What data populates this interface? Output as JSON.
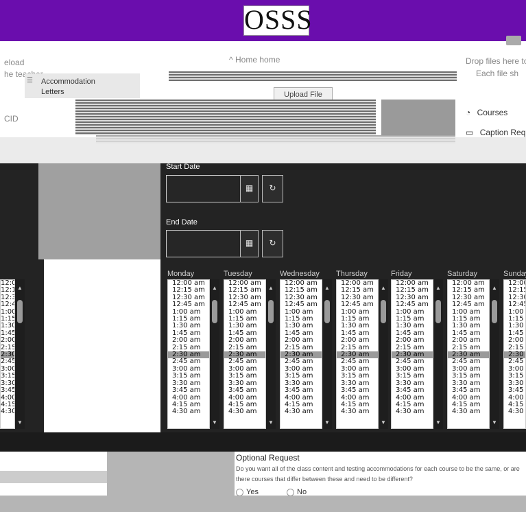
{
  "header": {
    "logo_text": "OSSS"
  },
  "nav": {
    "home_label": "Home",
    "home_crumb": "home",
    "upload_button": "Upload File",
    "drop_text": "Drop files here to",
    "each_file_text": "Each file sh",
    "left_top_text": "eload",
    "left_sub_text": "he teacher",
    "left_mid_text": "CID"
  },
  "menu": {
    "accommodation_letters": "Accommodation\nLetters"
  },
  "sidebar_right": {
    "courses": "Courses",
    "caption": "Caption Requ"
  },
  "form": {
    "start_date_label": "Start Date",
    "end_date_label": "End Date"
  },
  "schedule": {
    "days": [
      "Monday",
      "Tuesday",
      "Wednesday",
      "Thursday",
      "Friday",
      "Saturday",
      "Sunday"
    ],
    "times": [
      "12:00 am",
      "12:15 am",
      "12:30 am",
      "12:45 am",
      "1:00 am",
      "1:15 am",
      "1:30 am",
      "1:45 am",
      "2:00 am",
      "2:15 am",
      "2:30 am",
      "2:45 am",
      "3:00 am",
      "3:15 am",
      "3:30 am",
      "3:45 am",
      "4:00 am",
      "4:15 am",
      "4:30 am"
    ],
    "selected_time": "2:30 am"
  },
  "question": {
    "title": "Optional Request",
    "description": "Do you want all of the class content and testing accommodations for each course to be the same, or are there courses that differ between these and need to be different?",
    "yes": "Yes",
    "no": "No"
  },
  "colors": {
    "purple": "#6a0dad",
    "dark_panel": "#232323"
  }
}
